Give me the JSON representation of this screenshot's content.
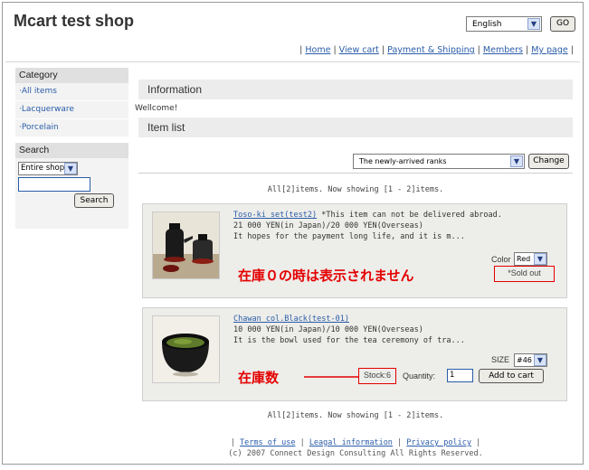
{
  "header": {
    "title": "Mcart test shop",
    "language": "English",
    "go_label": "GO"
  },
  "nav": {
    "links": [
      "Home",
      "View cart",
      "Payment & Shipping",
      "Members",
      "My page"
    ]
  },
  "sidebar": {
    "category_title": "Category",
    "items": [
      "All items",
      "Lacquerware",
      "Porcelain"
    ],
    "search_title": "Search",
    "search_scope": "Entire shop",
    "search_value": "",
    "search_button": "Search"
  },
  "main": {
    "information_title": "Information",
    "welcome_text": "Wellcome!",
    "item_list_title": "Item list",
    "sort_option": "The newly-arrived ranks",
    "change_button": "Change",
    "count_text": "All[2]items. Now showing [1 - 2]items."
  },
  "items": [
    {
      "name": "Toso-ki set(test2)",
      "note": " *This item can not be delivered abroad.",
      "price": "21 000 YEN(in Japan)/20 000 YEN(Overseas)",
      "description": "It hopes for the payment long life, and it is m...",
      "option_label": "Color",
      "option_value": "Red",
      "status": "*Sold out",
      "annotation": "在庫０の時は表示されません"
    },
    {
      "name": "Chawan col.Black(test-01)",
      "price": "10 000 YEN(in Japan)/10 000 YEN(Overseas)",
      "description": "It is the bowl used for the tea ceremony of tra...",
      "option_label": "SIZE",
      "option_value": "#46",
      "stock": "Stock:6",
      "quantity_label": "Quantity:",
      "quantity_value": "1",
      "add_button": "Add to cart",
      "annotation": "在庫数"
    }
  ],
  "footer": {
    "links": [
      "Terms of use",
      "Leagal information",
      "Privacy policy"
    ],
    "copyright": "(c) 2007 Connect Design Consulting All Rights Reserved."
  },
  "colors": {
    "link": "#2a5ca8",
    "annotation_red": "#e40000",
    "header_bg": "#ececec"
  }
}
